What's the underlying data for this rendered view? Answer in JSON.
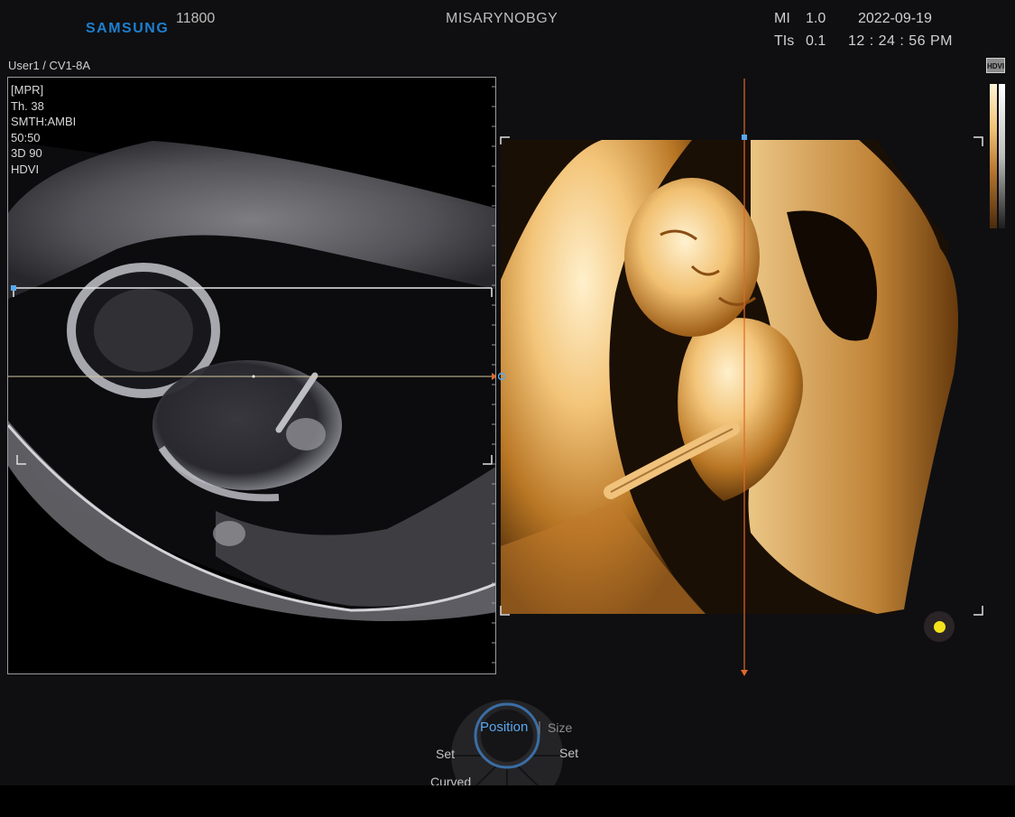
{
  "header": {
    "brand": "SAMSUNG",
    "probe_frequency": "11800",
    "patient_name": "MISARYNOBGY",
    "mi_label": "MI",
    "mi_value": "1.0",
    "tis_label": "TIs",
    "tis_value": "0.1",
    "date": "2022-09-19",
    "time": "12 : 24 : 56 PM",
    "user_probe": "User1 / CV1-8A"
  },
  "mpr_panel": {
    "params": [
      "[MPR]",
      "Th. 38",
      "SMTH:AMBI",
      "50:50",
      "3D 90",
      "HDVI"
    ]
  },
  "colorbar": {
    "badge": "HDVI"
  },
  "dial": {
    "position_label": "Position",
    "separator": "|",
    "size_label": "Size",
    "set_left_label": "Set",
    "set_right_label": "Set",
    "curved_label": "Curved"
  },
  "colors": {
    "brand": "#1d7fcf",
    "active_control": "#5aa7ee",
    "render_line": "#e0692a",
    "cursor": "#f4e21c"
  }
}
